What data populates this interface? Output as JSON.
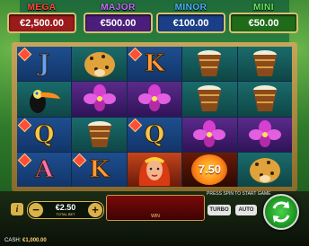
{
  "jackpots": [
    {
      "name": "MEGA",
      "value": "€2,500.00",
      "title_color": "#ff4a3a",
      "box_color": "#9a1b1b"
    },
    {
      "name": "MAJOR",
      "value": "€500.00",
      "title_color": "#c56cff",
      "box_color": "#4a1e7a"
    },
    {
      "name": "MINOR",
      "value": "€100.00",
      "title_color": "#4ab0ff",
      "box_color": "#1a3f86"
    },
    {
      "name": "MINI",
      "value": "€50.00",
      "title_color": "#69e45a",
      "box_color": "#1f6b1a"
    }
  ],
  "reels": [
    [
      "J",
      "jaguar",
      "K",
      "drum",
      "drum"
    ],
    [
      "toucan",
      "orchid",
      "orchid",
      "drum",
      "drum"
    ],
    [
      "Q",
      "drum",
      "Q",
      "orchid",
      "orchid"
    ],
    [
      "A",
      "K",
      "goddess",
      "7.50",
      "jaguar"
    ]
  ],
  "cash_value_symbol": "7.50",
  "message": "PRESS SPIN TO START GAME",
  "win_label": "WIN",
  "bet": {
    "value": "€2.50",
    "label": "TOTAL BET",
    "minus": "−",
    "plus": "+"
  },
  "buttons": {
    "info": "i",
    "turbo": "TURBO",
    "auto": "AUTO"
  },
  "cash": {
    "label": "CASH:",
    "value": "€1,000.00"
  }
}
